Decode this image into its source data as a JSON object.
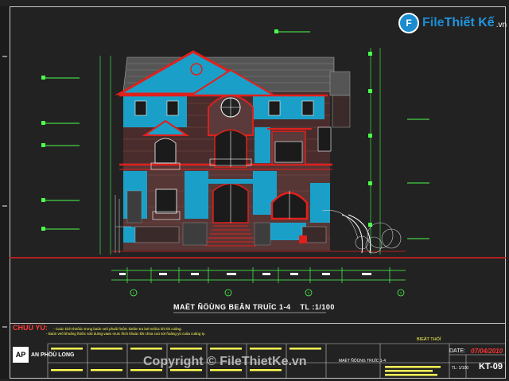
{
  "watermark": {
    "badge": "F",
    "brand_part1": "File",
    "brand_part2": "Thiết Kế",
    "brand_suffix": ".vn"
  },
  "drawing": {
    "title": "MAËT ÑÖÙNG BEÂN TRUÏC 1-4",
    "scale": "TL :1/100",
    "axis_markers": [
      "1",
      "2",
      "3",
      "4"
    ]
  },
  "title_block": {
    "notes_heading": "CHUÙ YÙ:",
    "notes_line1": "- Caùc kích thöôùc trong baûn veõ phaûi ñöôïc kieåm tra laïi tröôùc khi thi coâng.",
    "notes_line2": "- Baûn veõ khoâng ñöôïc söû duïng vaøo muïc ñích khaùc khi chöa coù söï ñoàng yù cuûa coâng ty.",
    "company_mark": "AP",
    "company_name": "AN PHÖÙ LONG",
    "stage_label": "BIEÄT THÖÏ",
    "sheet_title": "MAËT ÑÖÙNG TRUÏC 1-4",
    "date_label": "DATE:",
    "date_value": "07/04/2010",
    "scale_label": "TL: 1/100",
    "drawing_number": "KT-09"
  },
  "copyright": "Copyright © FileThietKe.vn",
  "colors": {
    "background": "#222222",
    "roof_red": "#e0201c",
    "wall_blue": "#1aa0c8",
    "line_green": "#4cff4c",
    "text_yellow": "#ffff55",
    "brand_blue": "#1a8ccf"
  }
}
